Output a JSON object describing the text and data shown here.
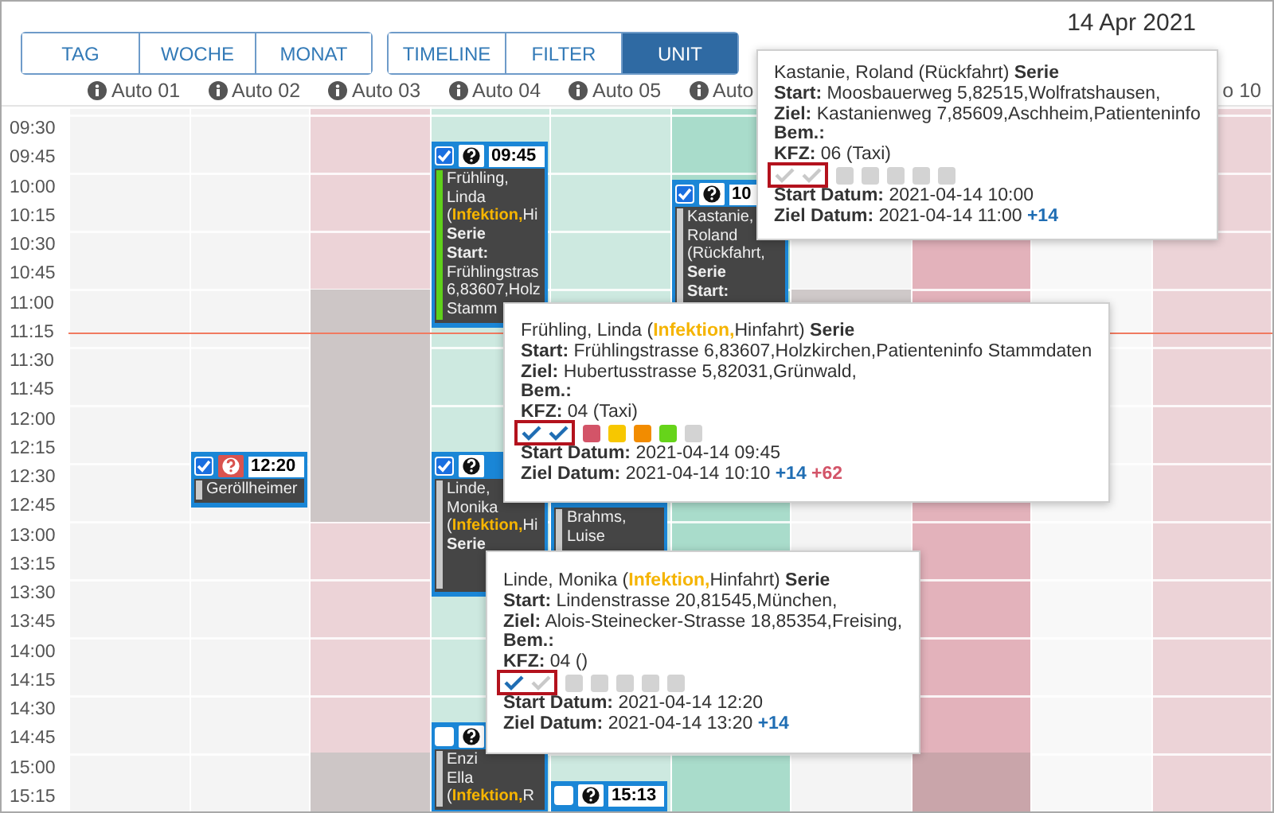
{
  "date": "14 Apr 2021",
  "view_buttons": [
    {
      "label": "TAG",
      "selected": false
    },
    {
      "label": "WOCHE",
      "selected": false
    },
    {
      "label": "MONAT",
      "selected": false
    }
  ],
  "mode_buttons": [
    {
      "label": "TIMELINE",
      "selected": false
    },
    {
      "label": "FILTER",
      "selected": false
    },
    {
      "label": "UNIT",
      "selected": true
    }
  ],
  "times": [
    "09:30",
    "09:45",
    "10:00",
    "10:15",
    "10:30",
    "10:45",
    "11:00",
    "11:15",
    "11:30",
    "11:45",
    "12:00",
    "12:15",
    "12:30",
    "12:45",
    "13:00",
    "13:15",
    "13:30",
    "13:45",
    "14:00",
    "14:15",
    "14:30",
    "14:45",
    "15:00",
    "15:15"
  ],
  "columns": [
    {
      "label": "Auto 01",
      "info": true,
      "color": "#f4f4f4"
    },
    {
      "label": "Auto 02",
      "info": true,
      "color": "#f4f4f4",
      "events": [
        {
          "checked": true,
          "alert": true,
          "time": "12:20",
          "color": "#c9c9c9",
          "lines": [
            [
              {
                "text": "Geröllheimer",
                "kind": "plain"
              }
            ]
          ]
        }
      ]
    },
    {
      "label": "Auto 03",
      "info": true,
      "color": "#ecd3d7",
      "blocks": [
        {
          "color": "#cdc6c6"
        },
        {
          "color": "#cdc6c6"
        }
      ]
    },
    {
      "label": "Auto 04",
      "info": true,
      "color": "#cde9e0",
      "events": [
        {
          "checked": true,
          "alert": false,
          "time": "09:45",
          "color": "#5fd11b",
          "lines": [
            [
              {
                "text": "Frühling,",
                "kind": "plain"
              }
            ],
            [
              {
                "text": "Linda",
                "kind": "plain"
              }
            ],
            [
              {
                "text": "(",
                "kind": "plain"
              },
              {
                "text": "Infektion,",
                "kind": "tag"
              },
              {
                "text": "Hi",
                "kind": "plain"
              }
            ],
            [
              {
                "text": "Serie",
                "kind": "bold"
              }
            ],
            [
              {
                "text": "Start:",
                "kind": "bold"
              }
            ],
            [
              {
                "text": "Frühlingstras",
                "kind": "plain"
              }
            ],
            [
              {
                "text": "6,83607,Holz",
                "kind": "plain"
              }
            ],
            [
              {
                "text": "Stamm",
                "kind": "plain"
              }
            ]
          ]
        },
        {
          "checked": true,
          "alert": false,
          "color": "#c9c9c9",
          "lines": [
            [
              {
                "text": "Linde,",
                "kind": "plain"
              }
            ],
            [
              {
                "text": "Monika",
                "kind": "plain"
              }
            ],
            [
              {
                "text": "(",
                "kind": "plain"
              },
              {
                "text": "Infektion,",
                "kind": "tag"
              },
              {
                "text": "Hi",
                "kind": "plain"
              }
            ],
            [
              {
                "text": "Serie",
                "kind": "bold"
              }
            ]
          ]
        },
        {
          "checked": false,
          "alert": false,
          "color": "#c9c9c9",
          "lines": [
            [
              {
                "text": "Enzi",
                "kind": "plain"
              }
            ],
            [
              {
                "text": "Ella",
                "kind": "plain"
              }
            ],
            [
              {
                "text": "(",
                "kind": "plain"
              },
              {
                "text": "Infektion,",
                "kind": "tag"
              },
              {
                "text": "R",
                "kind": "plain"
              }
            ]
          ]
        }
      ]
    },
    {
      "label": "Auto 05",
      "info": true,
      "color": "#cde9e0",
      "events": [
        {
          "color": "#c9c9c9",
          "lines": [
            [
              {
                "text": "Brahms,",
                "kind": "plain"
              }
            ],
            [
              {
                "text": "Luise",
                "kind": "plain"
              }
            ]
          ]
        },
        {
          "checked": false,
          "alert": false,
          "time": "15:13"
        }
      ]
    },
    {
      "label": "Auto",
      "info": true,
      "color": "#a9dccb",
      "events": [
        {
          "checked": true,
          "alert": false,
          "time": "10",
          "color": "#c9c9c9",
          "lines": [
            [
              {
                "text": "Kastanie,",
                "kind": "plain"
              }
            ],
            [
              {
                "text": "Roland",
                "kind": "plain"
              }
            ],
            [
              {
                "text": "(Rückfahrt,",
                "kind": "plain"
              }
            ],
            [
              {
                "text": "Serie",
                "kind": "bold"
              }
            ],
            [
              {
                "text": "Start:",
                "kind": "bold"
              }
            ]
          ]
        }
      ]
    },
    {
      "color": "#f4f4f4",
      "blocks": [
        {
          "color": "#cfc9c9"
        }
      ]
    },
    {
      "color": "#e3b2bb",
      "blocks": [
        {
          "color": "#c9a5aa"
        }
      ]
    },
    {
      "color": "#f8f8f8"
    },
    {
      "label": "o 10",
      "info": false,
      "color": "#ecd3d7"
    }
  ],
  "popups": [
    {
      "title": [
        {
          "text": "Kastanie, Roland (Rückfahrt) ",
          "kind": "plain"
        },
        {
          "text": "Serie",
          "kind": "bold"
        }
      ],
      "fields": [
        {
          "label": "Start:",
          "value": "Moosbauerweg 5,82515,Wolfratshausen,"
        },
        {
          "label": "Ziel:",
          "value": "Kastanienweg 7,85609,Aschheim,Patienteninfo"
        },
        {
          "label": "Bem.:"
        },
        {
          "label": "KFZ:",
          "value": "06 (Taxi)"
        }
      ],
      "ticks_highlighted": true,
      "ticks": [
        {
          "checked": false
        },
        {
          "checked": false
        }
      ],
      "squares": [
        {
          "color": "#d3d3d3"
        },
        {
          "color": "#d3d3d3"
        },
        {
          "color": "#d3d3d3"
        },
        {
          "color": "#d3d3d3"
        },
        {
          "color": "#d3d3d3"
        }
      ],
      "dates": [
        {
          "label": "Start Datum:",
          "value": "2021-04-14 10:00"
        },
        {
          "label": "Ziel Datum:",
          "value": "2021-04-14 11:00",
          "badges": [
            {
              "text": "+14",
              "color": "#1f6db3"
            }
          ]
        }
      ]
    },
    {
      "title": [
        {
          "text": "Frühling, Linda (",
          "kind": "plain"
        },
        {
          "text": "Infektion,",
          "kind": "tag"
        },
        {
          "text": "Hinfahrt) ",
          "kind": "plain"
        },
        {
          "text": "Serie",
          "kind": "bold"
        }
      ],
      "fields": [
        {
          "label": "Start:",
          "value": "Frühlingstrasse 6,83607,Holzkirchen,Patienteninfo Stammdaten"
        },
        {
          "label": "Ziel:",
          "value": "Hubertusstrasse 5,82031,Grünwald,"
        },
        {
          "label": "Bem.:"
        },
        {
          "label": "KFZ:",
          "value": "04 (Taxi)"
        }
      ],
      "ticks_highlighted": true,
      "ticks": [
        {
          "checked": true
        },
        {
          "checked": true
        }
      ],
      "squares": [
        {
          "color": "#d35468"
        },
        {
          "color": "#f7c700"
        },
        {
          "color": "#f28c00"
        },
        {
          "color": "#66d41a"
        },
        {
          "color": "#d3d3d3"
        }
      ],
      "dates": [
        {
          "label": "Start Datum:",
          "value": "2021-04-14 09:45"
        },
        {
          "label": "Ziel Datum:",
          "value": "2021-04-14 10:10",
          "badges": [
            {
              "text": "+14",
              "color": "#1f6db3"
            },
            {
              "text": "+62",
              "color": "#d35468"
            }
          ]
        }
      ]
    },
    {
      "title": [
        {
          "text": "Linde, Monika (",
          "kind": "plain"
        },
        {
          "text": "Infektion,",
          "kind": "tag"
        },
        {
          "text": "Hinfahrt) ",
          "kind": "plain"
        },
        {
          "text": "Serie",
          "kind": "bold"
        }
      ],
      "fields": [
        {
          "label": "Start:",
          "value": "Lindenstrasse 20,81545,München,"
        },
        {
          "label": "Ziel:",
          "value": "Alois-Steinecker-Strasse 18,85354,Freising,"
        },
        {
          "label": "Bem.:"
        },
        {
          "label": "KFZ:",
          "value": "04 ()"
        }
      ],
      "ticks_highlighted": true,
      "ticks": [
        {
          "checked": true
        },
        {
          "checked": false
        }
      ],
      "squares": [
        {
          "color": "#d3d3d3"
        },
        {
          "color": "#d3d3d3"
        },
        {
          "color": "#d3d3d3"
        },
        {
          "color": "#d3d3d3"
        },
        {
          "color": "#d3d3d3"
        }
      ],
      "dates": [
        {
          "label": "Start Datum:",
          "value": "2021-04-14 12:20"
        },
        {
          "label": "Ziel Datum:",
          "value": "2021-04-14 13:20",
          "badges": [
            {
              "text": "+14",
              "color": "#1f6db3"
            }
          ]
        }
      ]
    }
  ]
}
